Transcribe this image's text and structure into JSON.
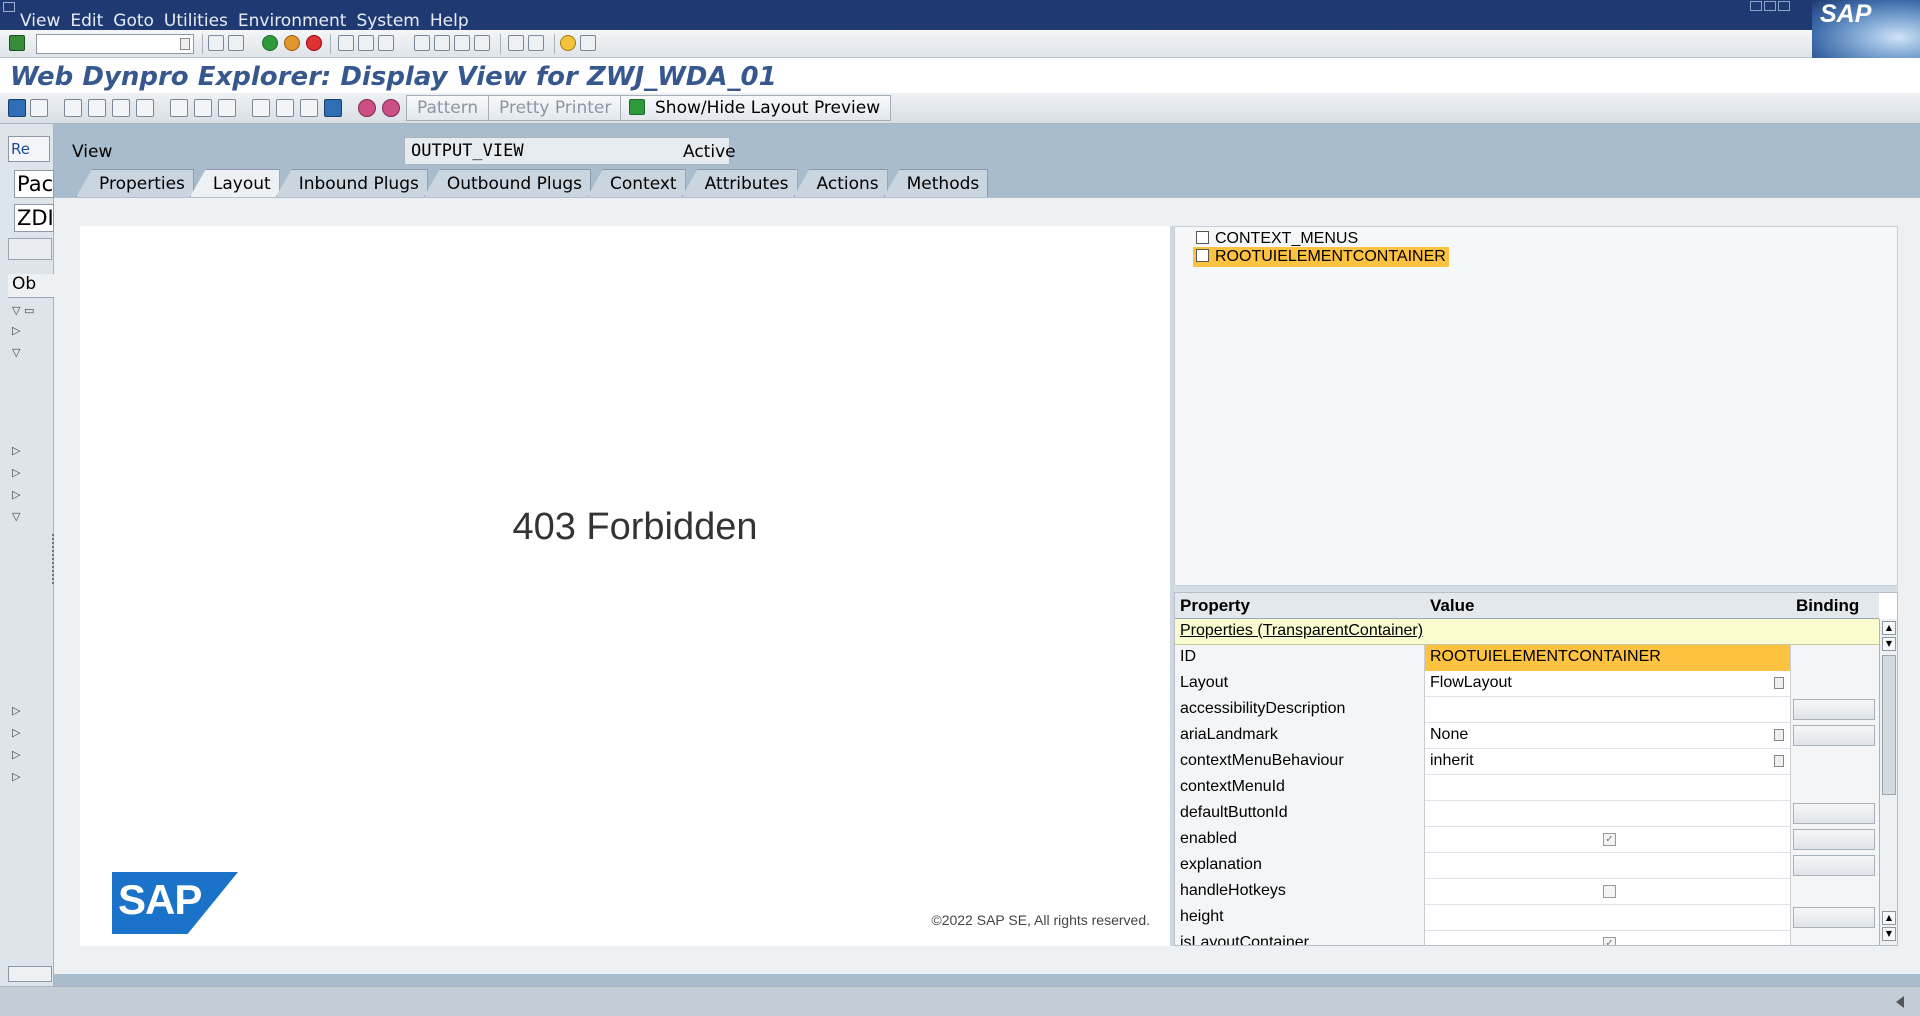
{
  "menubar": {
    "items": [
      "View",
      "Edit",
      "Goto",
      "Utilities",
      "Environment",
      "System",
      "Help"
    ],
    "logo_text": "SAP"
  },
  "title": "Web Dynpro Explorer: Display View for ZWJ_WDA_01",
  "app_toolbar": {
    "pattern_label": "Pattern",
    "pretty_printer_label": "Pretty Printer",
    "layout_preview_label": "Show/Hide Layout Preview"
  },
  "navigator": {
    "repo_label": "Re",
    "field1": "Pac",
    "field2": "ZDI",
    "obj_label": "Ob"
  },
  "view": {
    "label": "View",
    "name": "OUTPUT_VIEW",
    "status": "Active"
  },
  "tabs": [
    "Properties",
    "Layout",
    "Inbound Plugs",
    "Outbound Plugs",
    "Context",
    "Attributes",
    "Actions",
    "Methods"
  ],
  "active_tab": "Layout",
  "preview": {
    "message": "403 Forbidden",
    "logo_text": "SAP",
    "copyright": "©2022 SAP SE, All rights reserved."
  },
  "tree": {
    "nodes": [
      {
        "label": "CONTEXT_MENUS",
        "selected": false
      },
      {
        "label": "ROOTUIELEMENTCONTAINER",
        "selected": true
      }
    ]
  },
  "properties": {
    "headers": {
      "property": "Property",
      "value": "Value",
      "binding": "Binding"
    },
    "group": "Properties (TransparentContainer)",
    "rows": [
      {
        "name": "ID",
        "value": "ROOTUIELEMENTCONTAINER"
      },
      {
        "name": "Layout",
        "value": "FlowLayout"
      },
      {
        "name": "accessibilityDescription",
        "value": ""
      },
      {
        "name": "ariaLandmark",
        "value": "None"
      },
      {
        "name": "contextMenuBehaviour",
        "value": "inherit"
      },
      {
        "name": "contextMenuId",
        "value": ""
      },
      {
        "name": "defaultButtonId",
        "value": ""
      },
      {
        "name": "enabled",
        "value": ""
      },
      {
        "name": "explanation",
        "value": ""
      },
      {
        "name": "handleHotkeys",
        "value": ""
      },
      {
        "name": "height",
        "value": ""
      },
      {
        "name": "isLayoutContainer",
        "value": ""
      }
    ]
  },
  "colors": {
    "menubar": "#1f3a73",
    "title": "#37588f",
    "selection": "#fdc23f"
  }
}
